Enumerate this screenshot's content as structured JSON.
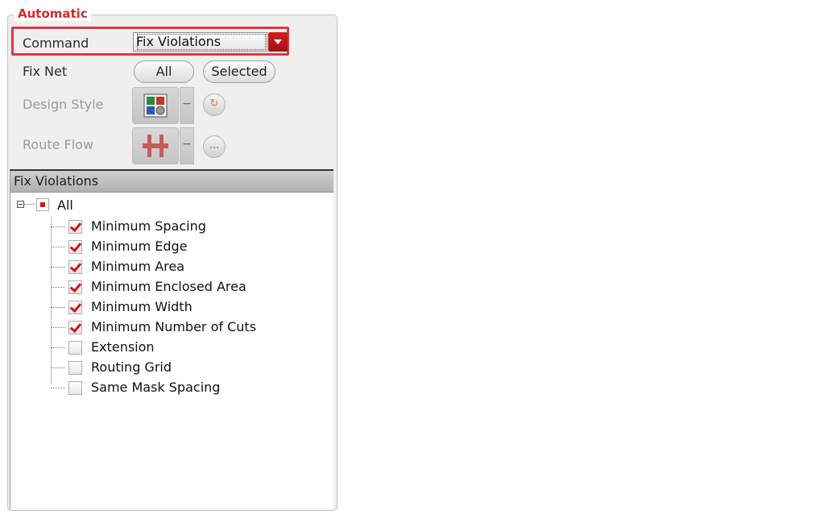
{
  "panel": {
    "title": "Automatic"
  },
  "command": {
    "label": "Command",
    "value": "Fix Violations"
  },
  "fix_net": {
    "label": "Fix Net",
    "all_label": "All",
    "selected_label": "Selected"
  },
  "design_style": {
    "label": "Design Style",
    "icon": "design-style-icon"
  },
  "route_flow": {
    "label": "Route Flow",
    "icon": "route-flow-icon",
    "more_label": "..."
  },
  "violations": {
    "header": "Fix Violations",
    "root_label": "All",
    "items": [
      {
        "label": "Minimum Spacing",
        "checked": true
      },
      {
        "label": "Minimum Edge",
        "checked": true
      },
      {
        "label": "Minimum Area",
        "checked": true
      },
      {
        "label": "Minimum Enclosed Area",
        "checked": true
      },
      {
        "label": "Minimum Width",
        "checked": true
      },
      {
        "label": "Minimum Number of Cuts",
        "checked": true
      },
      {
        "label": "Extension",
        "checked": false
      },
      {
        "label": "Routing Grid",
        "checked": false
      },
      {
        "label": "Same Mask Spacing",
        "checked": false
      }
    ]
  },
  "colors": {
    "accent": "#d22b2b",
    "highlight": "#e0373f",
    "check": "#d01515"
  }
}
